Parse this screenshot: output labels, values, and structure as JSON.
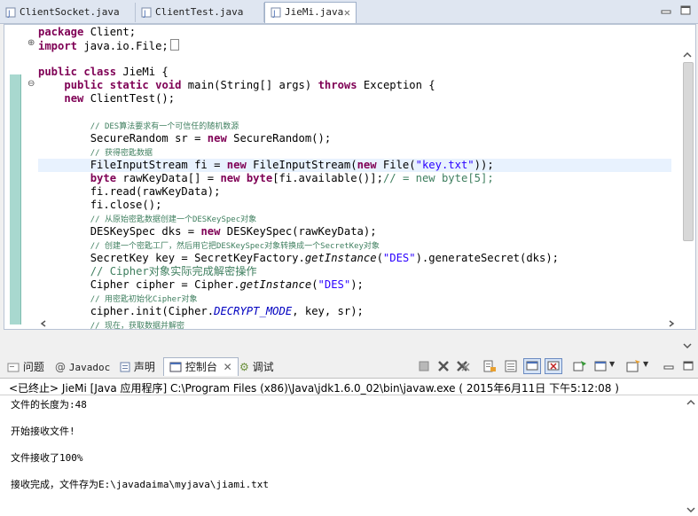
{
  "editor_tabs": [
    {
      "label": "ClientSocket.java",
      "active": false
    },
    {
      "label": "ClientTest.java",
      "active": false
    },
    {
      "label": "JieMi.java",
      "active": true
    }
  ],
  "code_lines": [
    {
      "parts": [
        {
          "t": "package",
          "c": "kw"
        },
        {
          "t": " Client;"
        }
      ]
    },
    {
      "parts": [
        {
          "t": "import",
          "c": "kw"
        },
        {
          "t": " java.io.File;"
        }
      ],
      "collapsed": true
    },
    {
      "parts": [
        {
          "t": ""
        }
      ]
    },
    {
      "parts": [
        {
          "t": "public",
          "c": "kw"
        },
        {
          "t": " "
        },
        {
          "t": "class",
          "c": "kw"
        },
        {
          "t": " JieMi {"
        }
      ]
    },
    {
      "parts": [
        {
          "t": "    "
        },
        {
          "t": "public",
          "c": "kw"
        },
        {
          "t": " "
        },
        {
          "t": "static",
          "c": "kw"
        },
        {
          "t": " "
        },
        {
          "t": "void",
          "c": "kw"
        },
        {
          "t": " main(String[] args) "
        },
        {
          "t": "throws",
          "c": "kw"
        },
        {
          "t": " Exception {"
        }
      ]
    },
    {
      "parts": [
        {
          "t": "    "
        },
        {
          "t": "new",
          "c": "kw"
        },
        {
          "t": " ClientTest();"
        }
      ]
    },
    {
      "parts": [
        {
          "t": ""
        }
      ]
    },
    {
      "parts": [
        {
          "t": "        "
        },
        {
          "t": "// DES算法要求有一个可信任的随机数源",
          "c": "cm-small"
        }
      ]
    },
    {
      "parts": [
        {
          "t": "        SecureRandom sr = "
        },
        {
          "t": "new",
          "c": "kw"
        },
        {
          "t": " SecureRandom();"
        }
      ]
    },
    {
      "parts": [
        {
          "t": "        "
        },
        {
          "t": "// 获得密匙数据",
          "c": "cm-small"
        }
      ]
    },
    {
      "parts": [
        {
          "t": "        FileInputStream fi = "
        },
        {
          "t": "new",
          "c": "kw"
        },
        {
          "t": " FileInputStream("
        },
        {
          "t": "new",
          "c": "kw"
        },
        {
          "t": " File("
        },
        {
          "t": "\"key.txt\"",
          "c": "str"
        },
        {
          "t": "));"
        }
      ],
      "hl": true
    },
    {
      "parts": [
        {
          "t": "        "
        },
        {
          "t": "byte",
          "c": "kw"
        },
        {
          "t": " rawKeyData[] = "
        },
        {
          "t": "new",
          "c": "kw"
        },
        {
          "t": " "
        },
        {
          "t": "byte",
          "c": "kw"
        },
        {
          "t": "[fi.available()];"
        },
        {
          "t": "// = new byte[5];",
          "c": "cm"
        }
      ]
    },
    {
      "parts": [
        {
          "t": "        fi.read(rawKeyData);"
        }
      ]
    },
    {
      "parts": [
        {
          "t": "        fi.close();"
        }
      ]
    },
    {
      "parts": [
        {
          "t": "        "
        },
        {
          "t": "// 从原始密匙数据创建一个DESKeySpec对象",
          "c": "cm-small"
        }
      ]
    },
    {
      "parts": [
        {
          "t": "        DESKeySpec dks = "
        },
        {
          "t": "new",
          "c": "kw"
        },
        {
          "t": " DESKeySpec(rawKeyData);"
        }
      ]
    },
    {
      "parts": [
        {
          "t": "        "
        },
        {
          "t": "// 创建一个密匙工厂，然后用它把DESKeySpec对象转换成一个SecretKey对象",
          "c": "cm-small"
        }
      ]
    },
    {
      "parts": [
        {
          "t": "        SecretKey key = SecretKeyFactory."
        },
        {
          "t": "getInstance",
          "c": "it"
        },
        {
          "t": "("
        },
        {
          "t": "\"DES\"",
          "c": "str"
        },
        {
          "t": ").generateSecret(dks);"
        }
      ]
    },
    {
      "parts": [
        {
          "t": "        "
        },
        {
          "t": "// Cipher对象实际完成解密操作",
          "c": "cm"
        }
      ]
    },
    {
      "parts": [
        {
          "t": "        Cipher cipher = Cipher."
        },
        {
          "t": "getInstance",
          "c": "it"
        },
        {
          "t": "("
        },
        {
          "t": "\"DES\"",
          "c": "str"
        },
        {
          "t": ");"
        }
      ]
    },
    {
      "parts": [
        {
          "t": "        "
        },
        {
          "t": "// 用密匙初始化Cipher对象",
          "c": "cm-small"
        }
      ]
    },
    {
      "parts": [
        {
          "t": "        cipher.init(Cipher."
        },
        {
          "t": "DECRYPT_MODE",
          "c": "fld"
        },
        {
          "t": ", key, sr);"
        }
      ]
    },
    {
      "parts": [
        {
          "t": "        "
        },
        {
          "t": "// 现在，获取数据并解密",
          "c": "cm-small"
        }
      ]
    }
  ],
  "console_tabs": [
    {
      "label": "问题",
      "icon": "problems-icon",
      "active": false
    },
    {
      "label": "Javadoc",
      "icon": "javadoc-icon",
      "active": false
    },
    {
      "label": "声明",
      "icon": "declaration-icon",
      "active": false
    },
    {
      "label": "控制台",
      "icon": "console-icon",
      "active": true
    },
    {
      "label": "调试",
      "icon": "debug-icon",
      "active": false
    }
  ],
  "console": {
    "status": "<已终止> JieMi [Java 应用程序] C:\\Program Files (x86)\\Java\\jdk1.6.0_02\\bin\\javaw.exe ( 2015年6月11日 下午5:12:08 )",
    "output": [
      "文件的长度为:48",
      "开始接收文件!",
      "文件接收了100%",
      "接收完成，文件存为E:\\javadaima\\myjava\\jiami.txt"
    ]
  },
  "colors": {
    "keyword": "#7f0055",
    "comment": "#3f7f5f",
    "string": "#2a00ff",
    "highlight_line": "#e8f2fe",
    "change_ruler": "#a8d8cf"
  }
}
